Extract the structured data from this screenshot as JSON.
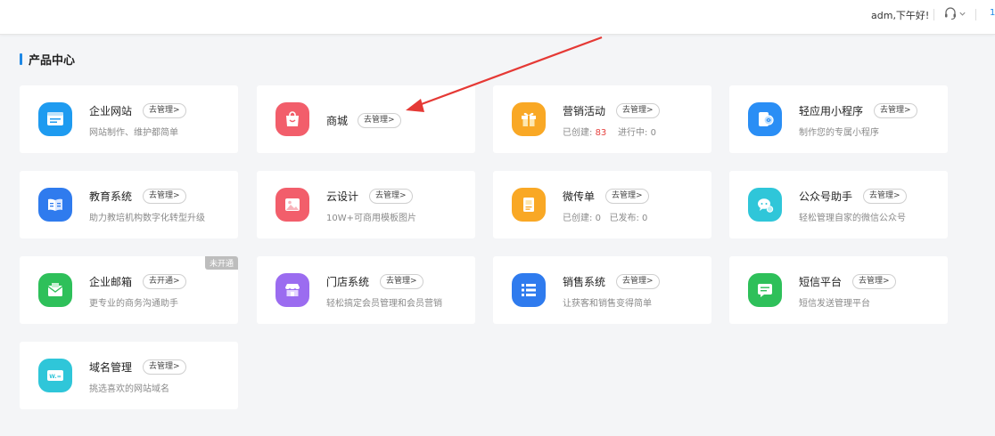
{
  "header": {
    "greeting": "adm,下午好!",
    "support_icon": "headset-icon",
    "dropdown_icon": "chevron-down-icon",
    "extra": "1"
  },
  "section": {
    "title": "产品中心"
  },
  "manage_label": "去管理>",
  "open_label": "去开通>",
  "cards": {
    "website": {
      "name": "企业网站",
      "desc": "网站制作、维护都简单",
      "icon": "website-icon",
      "color": "#1e9bf0"
    },
    "mall": {
      "name": "商城",
      "icon": "shopping-bag-icon",
      "color": "#f25e6b"
    },
    "marketing": {
      "name": "营销活动",
      "created_label": "已创建:",
      "created_value": "83",
      "running_label": "进行中:",
      "running_value": "0",
      "icon": "gift-icon",
      "color": "#f9a825"
    },
    "miniapp": {
      "name": "轻应用小程序",
      "desc": "制作您的专属小程序",
      "icon": "miniapp-icon",
      "color": "#2a8ef5"
    },
    "education": {
      "name": "教育系统",
      "desc": "助力教培机构数字化转型升级",
      "icon": "book-icon",
      "color": "#2f7bee"
    },
    "clouddesign": {
      "name": "云设计",
      "desc": "10W+可商用模板图片",
      "icon": "image-icon",
      "color": "#f25e6b"
    },
    "microflyer": {
      "name": "微传单",
      "created_label": "已创建:",
      "created_value": "0",
      "published_label": "已发布:",
      "published_value": "0",
      "icon": "flyer-icon",
      "color": "#f9a825"
    },
    "official": {
      "name": "公众号助手",
      "desc": "轻松管理自家的微信公众号",
      "icon": "wechat-icon",
      "color": "#2fc6d9"
    },
    "email": {
      "name": "企业邮箱",
      "desc": "更专业的商务沟通助手",
      "ribbon": "未开通",
      "icon": "mail-icon",
      "color": "#2ec05a"
    },
    "store": {
      "name": "门店系统",
      "desc": "轻松搞定会员管理和会员营销",
      "icon": "store-icon",
      "color": "#9b6cf0"
    },
    "sales": {
      "name": "销售系统",
      "desc": "让获客和销售变得简单",
      "icon": "list-icon",
      "color": "#2f7bee"
    },
    "sms": {
      "name": "短信平台",
      "desc": "短信发送管理平台",
      "icon": "sms-icon",
      "color": "#2ec05a"
    },
    "domain": {
      "name": "域名管理",
      "desc": "挑选喜欢的网站域名",
      "icon": "domain-icon",
      "color": "#2fc6d9"
    }
  }
}
